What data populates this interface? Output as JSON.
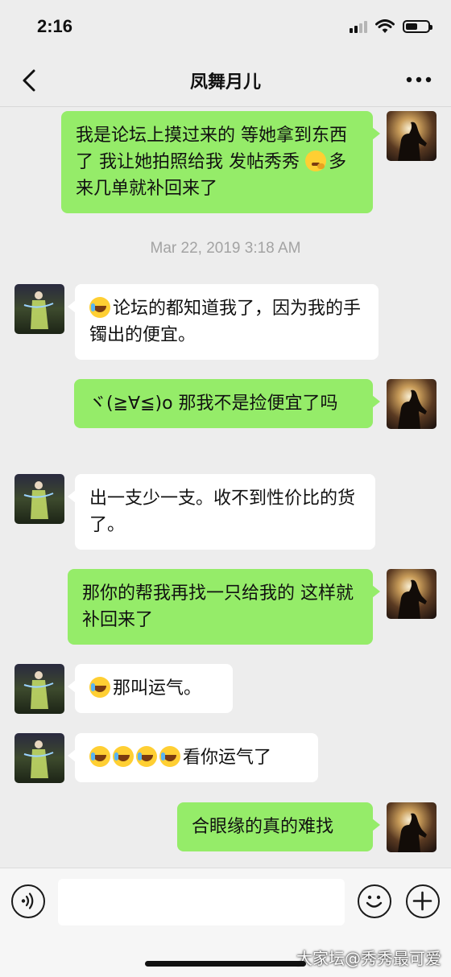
{
  "status_bar": {
    "time": "2:16",
    "battery_level": 0.55
  },
  "header": {
    "title": "凤舞月儿",
    "back_icon": "chevron-left-icon",
    "more_icon": "more-dots-icon"
  },
  "messages": [
    {
      "side": "me",
      "text": "我是论坛上摸过来的 等她拿到东西了 我让她拍照给我 发帖秀秀 ",
      "emoji": "thinking-face",
      "text_after": "多来几单就补回来了"
    },
    {
      "type": "timestamp",
      "text": "Mar 22, 2019 3:18 AM"
    },
    {
      "side": "other",
      "emoji": "crying-laughing-face",
      "text": "论坛的都知道我了，因为我的手镯出的便宜。"
    },
    {
      "side": "me",
      "text": "ヾ(≧∀≦)o 那我不是捡便宜了吗"
    },
    {
      "side": "other",
      "text": "出一支少一支。收不到性价比的货了。"
    },
    {
      "side": "me",
      "text": "那你的帮我再找一只给我的 这样就补回来了"
    },
    {
      "side": "other",
      "emoji": "crying-laughing-face",
      "text": "那叫运气。"
    },
    {
      "side": "other",
      "emoji_count": 4,
      "text": "看你运气了"
    },
    {
      "side": "me",
      "text": "合眼缘的真的难找"
    }
  ],
  "input_bar": {
    "placeholder": "",
    "voice_icon": "voice-icon",
    "emoji_icon": "emoji-icon",
    "plus_icon": "plus-icon"
  },
  "watermark": "大家坛@秀秀最可爱",
  "colors": {
    "my_bubble": "#95ec69",
    "other_bubble": "#ffffff",
    "background": "#ededed"
  }
}
